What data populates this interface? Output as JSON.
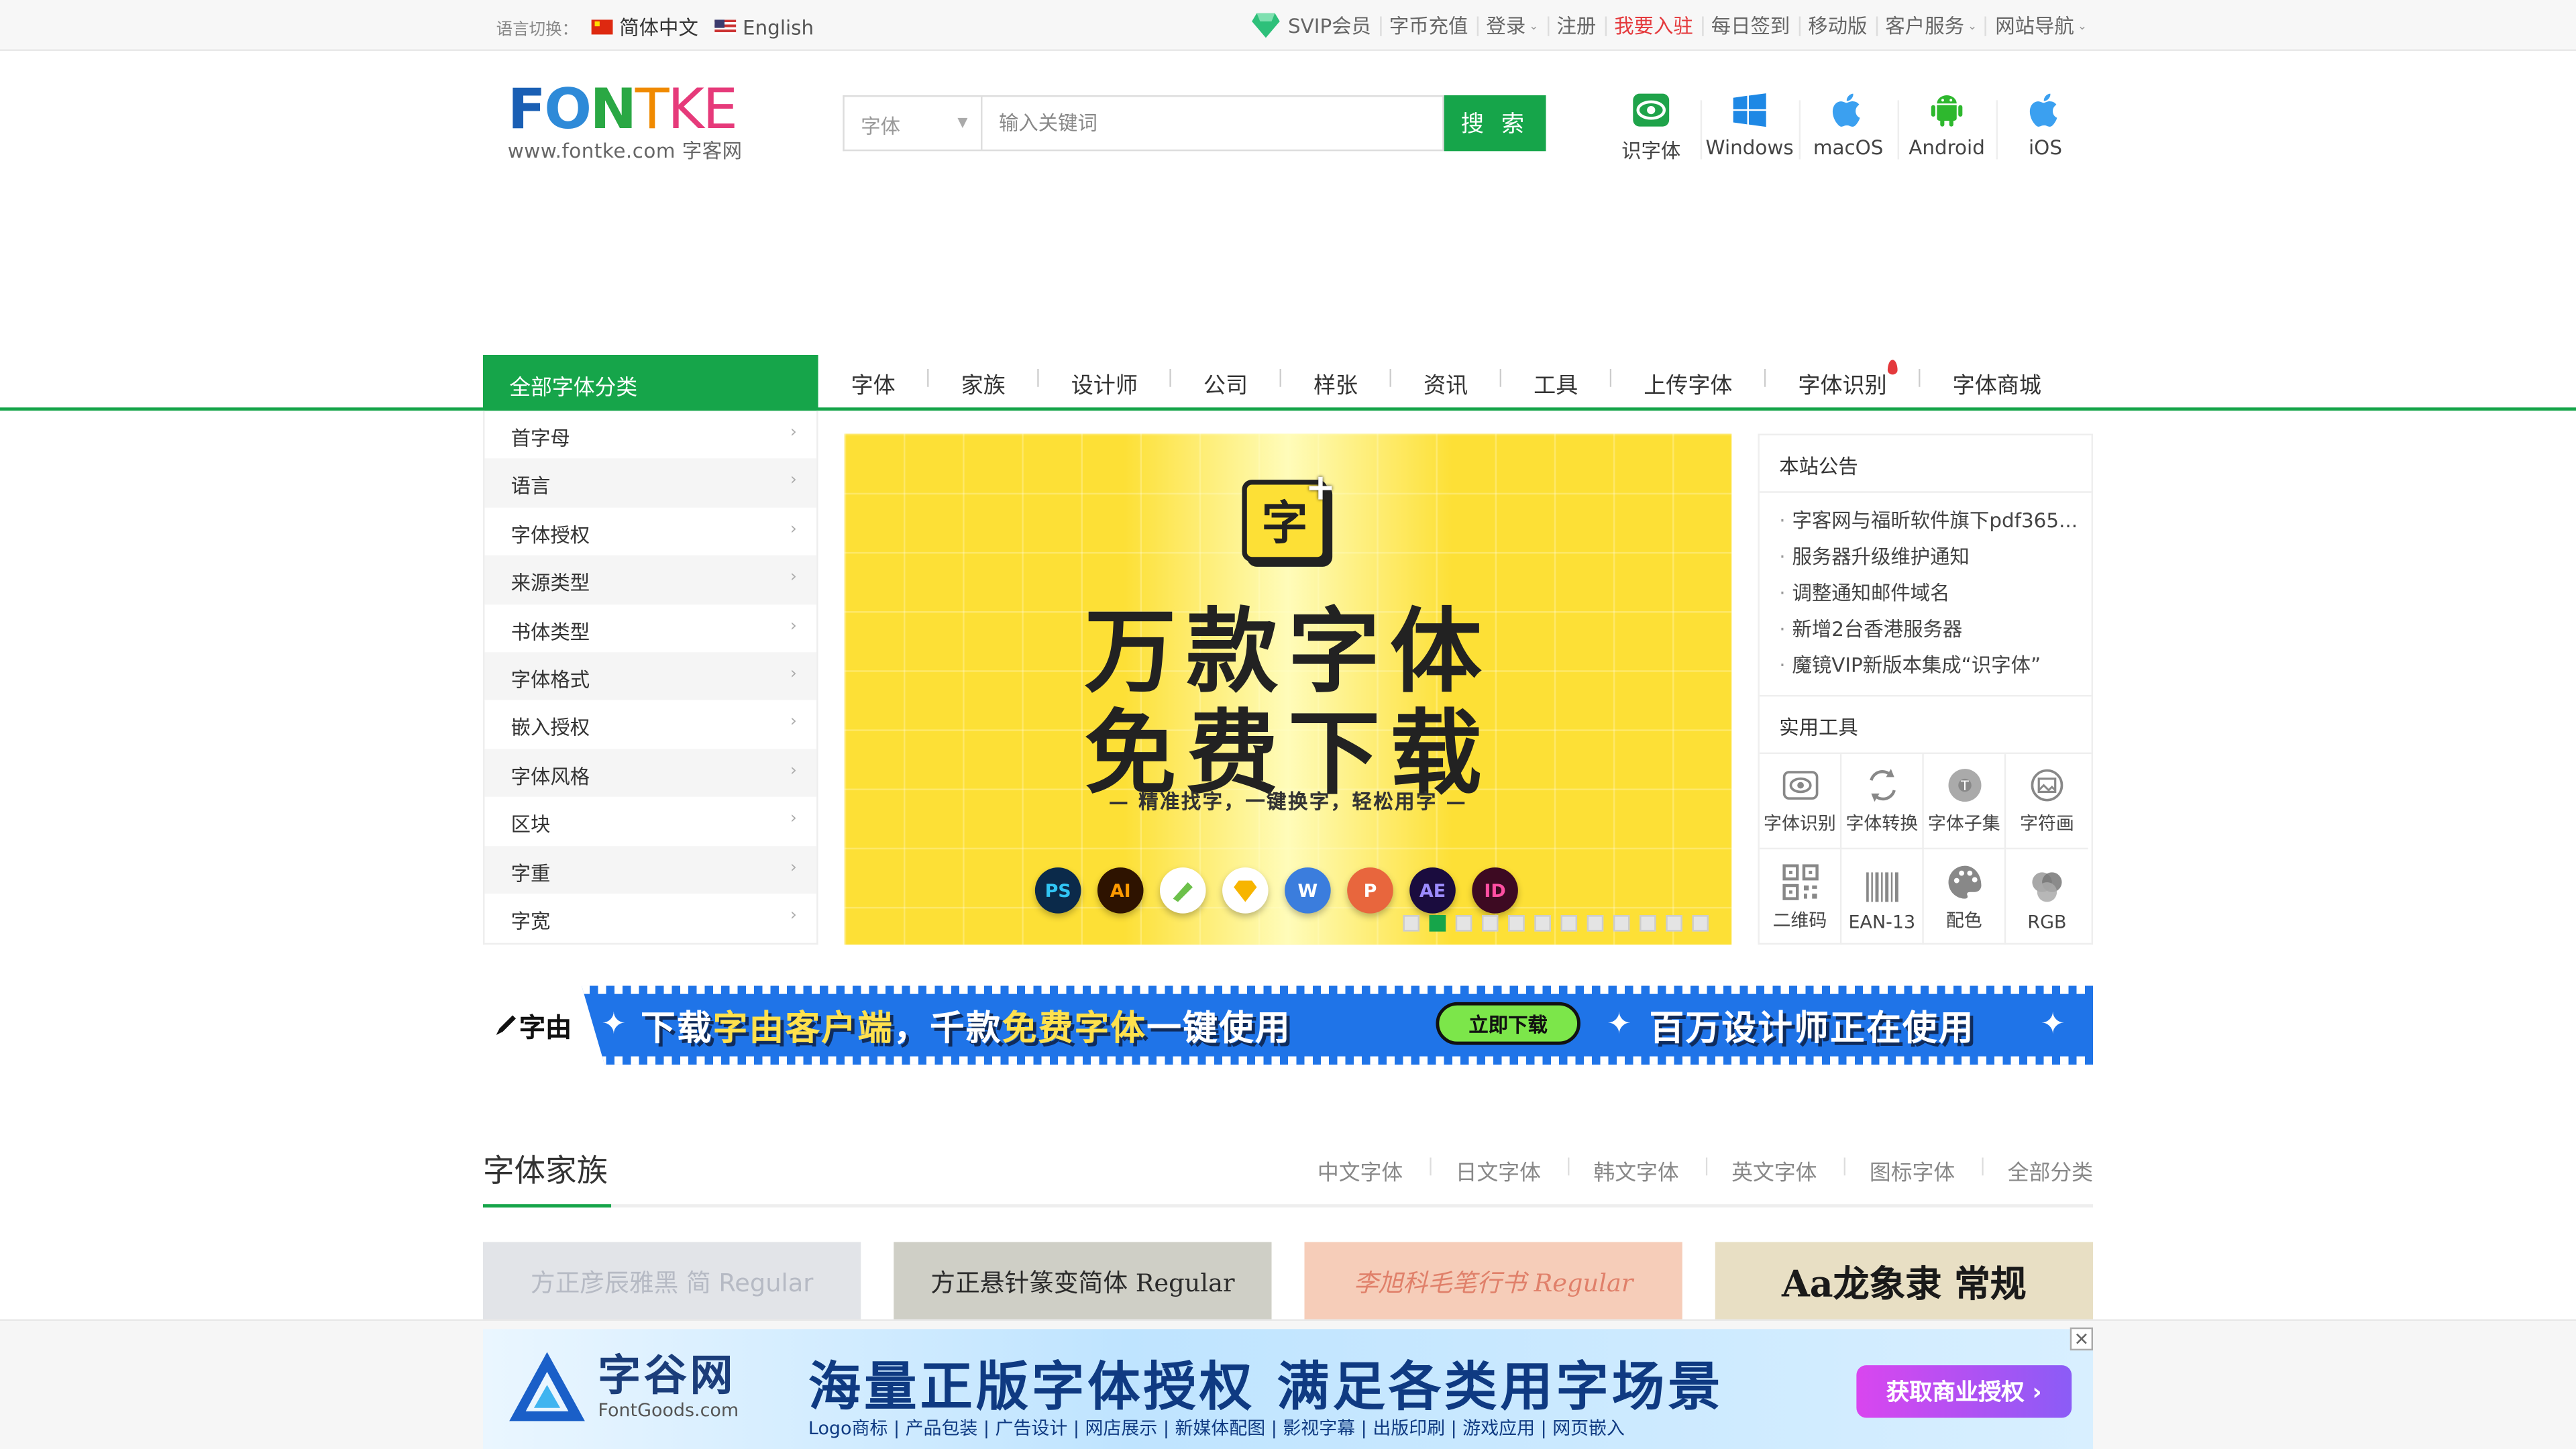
{
  "topbar": {
    "lang_label": "语言切换：",
    "lang_cn": "简体中文",
    "lang_en": "English",
    "links": [
      "SVIP会员",
      "字币充值",
      "登录",
      "注册",
      "我要入驻",
      "每日签到",
      "移动版",
      "客户服务",
      "网站导航"
    ]
  },
  "header": {
    "logo_sub": "www.fontke.com 字客网",
    "search_type": "字体",
    "search_placeholder": "输入关键词",
    "search_button": "搜 索",
    "platforms": [
      "识字体",
      "Windows",
      "macOS",
      "Android",
      "iOS"
    ]
  },
  "nav": {
    "all_categories": "全部字体分类",
    "items": [
      "字体",
      "家族",
      "设计师",
      "公司",
      "样张",
      "资讯",
      "工具",
      "上传字体",
      "字体识别",
      "字体商城"
    ]
  },
  "sidebar": {
    "items": [
      "首字母",
      "语言",
      "字体授权",
      "来源类型",
      "书体类型",
      "字体格式",
      "嵌入授权",
      "字体风格",
      "区块",
      "字重",
      "字宽"
    ]
  },
  "banner": {
    "line1": "万款字体",
    "line2": "免费下载",
    "tagline": "— 精准找字，一键换字，轻松用字 —",
    "apps": [
      "PS",
      "AI",
      "",
      "",
      "W",
      "P",
      "AE",
      "ID"
    ],
    "slide_count": 12,
    "active_slide": 2
  },
  "notice": {
    "title": "本站公告",
    "items": [
      "字客网与福昕软件旗下pdf365...",
      "服务器升级维护通知",
      "调整通知邮件域名",
      "新增2台香港服务器",
      "魔镜VIP新版本集成“识字体”"
    ]
  },
  "tools": {
    "title": "实用工具",
    "items": [
      "字体识别",
      "字体转换",
      "字体子集",
      "字符画",
      "二维码",
      "EAN-13",
      "配色",
      "RGB"
    ]
  },
  "strip_ad": {
    "brand": "字由",
    "msg_a": "下载",
    "msg_b": "字由客户端",
    "msg_c": "，千款",
    "msg_d": "免费字体",
    "msg_e": "一键使用",
    "cta": "立即下载",
    "msg2": "百万设计师正在使用"
  },
  "families": {
    "title": "字体家族",
    "links": [
      "中文字体",
      "日文字体",
      "韩文字体",
      "英文字体",
      "图标字体",
      "全部分类"
    ],
    "cards": [
      "方正彦辰雅黑 简 Regular",
      "方正悬针篆变简体 Regular",
      "李旭科毛笔行书 Regular",
      "Aa龙象隶 常规"
    ]
  },
  "bottom_ad": {
    "brand": "字谷网",
    "site": "FontGoods.com",
    "headline": "海量正版字体授权  满足各类用字场景",
    "subline": "Logo商标 | 产品包装 | 广告设计 | 网店展示 | 新媒体配图 | 影视字幕 | 出版印刷 | 游戏应用 | 网页嵌入",
    "button": "获取商业授权 ›",
    "close": "✕"
  },
  "colors": {
    "accent": "#16a54a",
    "banner_bg": "#fde036",
    "red": "#e4393c",
    "strip_blue": "#1f74e8"
  }
}
